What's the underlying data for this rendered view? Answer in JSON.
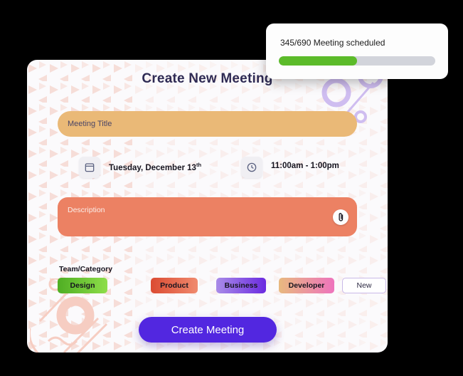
{
  "toast": {
    "message": "345/690 Meeting scheduled",
    "progress_percent": 50,
    "progress_fill_color": "#5cbb2a",
    "progress_track_color": "#d2d4db"
  },
  "card": {
    "title": "Create New Meeting",
    "title_color": "#2f2b54",
    "background": "#fbfafc",
    "title_field": {
      "placeholder": "Meeting Title",
      "value": "",
      "background": "#eab977"
    },
    "date": {
      "icon": "calendar-icon",
      "text_main": "Tuesday, December 13",
      "text_suffix": "th"
    },
    "time": {
      "icon": "clock-icon",
      "text": "11:00am - 1:00pm"
    },
    "description_field": {
      "placeholder": "Description",
      "value": "",
      "background": "#ec8163",
      "attachment_icon": "paperclip-icon"
    },
    "team_category": {
      "label": "Team/Category",
      "tags": [
        {
          "label": "Design",
          "color_from": "#4fae23",
          "color_to": "#8ede4a"
        },
        {
          "label": "Product",
          "color_from": "#db4b32",
          "color_to": "#f08a6e"
        },
        {
          "label": "Business",
          "color_from": "#a98ce8",
          "color_to": "#6b2ae0"
        },
        {
          "label": "Developer",
          "color_from": "#e8b97f",
          "color_to": "#ee74bd"
        },
        {
          "label": "New",
          "color_from": "#ffffff",
          "color_to": "#ffffff"
        }
      ]
    },
    "submit_button": {
      "label": "Create Meeting",
      "color": "#5227e0"
    }
  }
}
